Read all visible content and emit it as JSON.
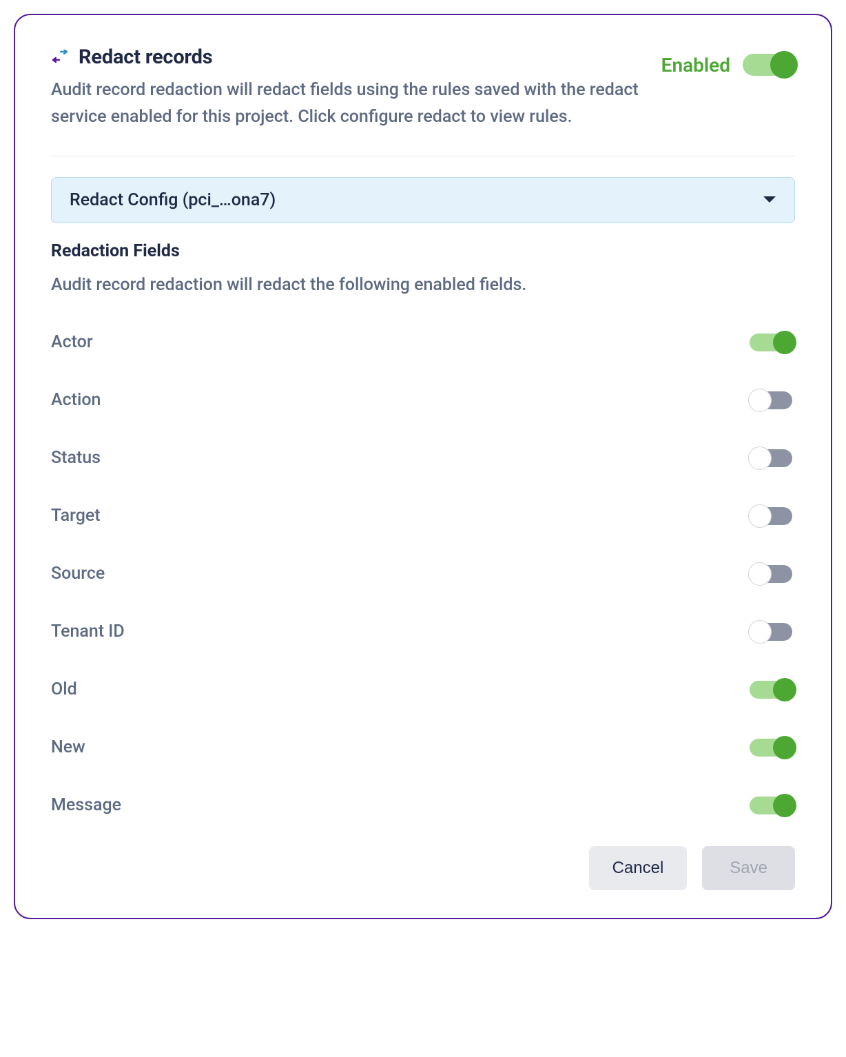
{
  "header": {
    "title": "Redact records",
    "description": "Audit record redaction will redact fields using the rules saved with the redact service enabled for this project. Click configure redact to view rules.",
    "enabled_label": "Enabled",
    "enabled": true
  },
  "config_select": {
    "label": "Redact Config (pci_…ona7)"
  },
  "fields_section": {
    "title": "Redaction Fields",
    "description": "Audit record redaction will redact the following enabled fields."
  },
  "fields": [
    {
      "label": "Actor",
      "enabled": true
    },
    {
      "label": "Action",
      "enabled": false
    },
    {
      "label": "Status",
      "enabled": false
    },
    {
      "label": "Target",
      "enabled": false
    },
    {
      "label": "Source",
      "enabled": false
    },
    {
      "label": "Tenant ID",
      "enabled": false
    },
    {
      "label": "Old",
      "enabled": true
    },
    {
      "label": "New",
      "enabled": true
    },
    {
      "label": "Message",
      "enabled": true
    }
  ],
  "buttons": {
    "cancel": "Cancel",
    "save": "Save"
  },
  "colors": {
    "accent_purple": "#551C9C",
    "toggle_on": "#4CA733",
    "toggle_on_track": "#A6DB93",
    "toggle_off_track": "#8D93A2",
    "text_heading": "#1F2945",
    "text_muted": "#5E6A82",
    "select_bg": "#E4F3FB"
  }
}
